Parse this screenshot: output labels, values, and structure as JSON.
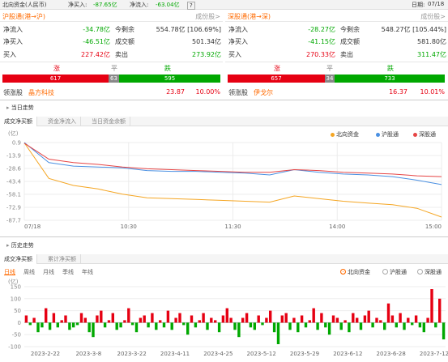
{
  "header": {
    "title": "北向资金(人民币)",
    "net_buy_label": "净买入:",
    "net_buy_value": "-87.65亿",
    "net_inflow_label": "净流入:",
    "net_inflow_value": "-63.04亿",
    "help": "?",
    "date_label": "日期:",
    "date_value": "07/18"
  },
  "sh": {
    "title": "沪股通(港→沪)",
    "link": "成份股>",
    "net_inflow_label": "净流入",
    "net_inflow_value": "-34.78亿",
    "remaining_label": "今剩余",
    "remaining_value": "554.78亿 [106.69%]",
    "net_buy_label": "净买入",
    "net_buy_value": "-46.51亿",
    "turnover_label": "成交额",
    "turnover_value": "501.34亿",
    "buy_label": "买入",
    "buy_value": "227.42亿",
    "sell_label": "卖出",
    "sell_value": "273.92亿",
    "up_label": "涨",
    "flat_label": "平",
    "down_label": "跌",
    "up_count": "617",
    "flat_count": "63",
    "down_count": "595",
    "leader_label": "领涨股",
    "leader_name": "晶方科技",
    "leader_price": "23.87",
    "leader_pct": "10.00%"
  },
  "sz": {
    "title": "深股通(港→深)",
    "link": "成份股>",
    "net_inflow_label": "净流入",
    "net_inflow_value": "-28.27亿",
    "remaining_label": "今剩余",
    "remaining_value": "548.27亿 [105.44%]",
    "net_buy_label": "净买入",
    "net_buy_value": "-41.15亿",
    "turnover_label": "成交额",
    "turnover_value": "581.80亿",
    "buy_label": "买入",
    "buy_value": "270.33亿",
    "sell_label": "卖出",
    "sell_value": "311.47亿",
    "up_label": "涨",
    "flat_label": "平",
    "down_label": "跌",
    "up_count": "657",
    "flat_count": "34",
    "down_count": "733",
    "leader_label": "领涨股",
    "leader_name": "伊戈尔",
    "leader_price": "16.37",
    "leader_pct": "10.01%"
  },
  "intraday": {
    "section_title": "当日走势",
    "tabs": [
      "成交净买额",
      "资金净流入",
      "当日资金余额"
    ],
    "unit": "(亿)",
    "legend": [
      "北向资金",
      "沪股通",
      "深股通"
    ]
  },
  "history": {
    "section_title": "历史走势",
    "tabs": [
      "成交净买额",
      "累计净买额"
    ],
    "periods": [
      "日线",
      "周线",
      "月线",
      "季线",
      "年线"
    ],
    "series_options": [
      "北向资金",
      "沪股通",
      "深股通"
    ],
    "unit": "(亿)"
  },
  "colors": {
    "north": "#f5a623",
    "sh": "#4a90e2",
    "sz": "#e64545",
    "up": "#e60012",
    "down": "#00a800",
    "accent": "#ff6a00"
  },
  "chart_data": [
    {
      "type": "line",
      "x_ticks": [
        "07/18",
        "10:30",
        "11:30",
        "14:00",
        "15:00"
      ],
      "y_ticks": [
        0.9,
        -13.9,
        -28.6,
        -43.4,
        -58.1,
        -72.9,
        -87.7
      ],
      "ylim": [
        -87.7,
        0.9
      ],
      "x": [
        "09:30",
        "09:45",
        "10:00",
        "10:15",
        "10:30",
        "10:45",
        "11:00",
        "11:15",
        "11:30",
        "13:00",
        "13:15",
        "13:30",
        "13:45",
        "14:00",
        "14:15",
        "14:30",
        "14:45",
        "15:00"
      ],
      "series": [
        {
          "name": "北向资金",
          "values": [
            0.5,
            -40,
            -48,
            -52,
            -58,
            -62,
            -63,
            -64,
            -65,
            -66,
            -67,
            -60,
            -63,
            -66,
            -68,
            -70,
            -74,
            -84
          ]
        },
        {
          "name": "沪股通",
          "values": [
            0.9,
            -22,
            -26,
            -27,
            -28,
            -31,
            -32,
            -32,
            -33,
            -34,
            -36,
            -30,
            -33,
            -35,
            -36,
            -38,
            -42,
            -47
          ]
        },
        {
          "name": "深股通",
          "values": [
            0.2,
            -18,
            -22,
            -24,
            -27,
            -29,
            -30,
            -31,
            -32,
            -33,
            -33,
            -30,
            -31,
            -33,
            -34,
            -35,
            -37,
            -38
          ]
        }
      ]
    },
    {
      "type": "bar",
      "x_ticks": [
        "2023-2-22",
        "2023-3-8",
        "2023-3-22",
        "2023-4-11",
        "2023-4-25",
        "2023-5-12",
        "2023-5-29",
        "2023-6-12",
        "2023-6-28",
        "2023-7-12"
      ],
      "y_ticks": [
        150,
        100,
        50,
        0,
        -50,
        -100
      ],
      "ylim": [
        -100,
        150
      ],
      "values": [
        30,
        -10,
        20,
        -40,
        -20,
        60,
        -30,
        40,
        -20,
        10,
        30,
        -30,
        -20,
        -10,
        40,
        20,
        -40,
        -60,
        30,
        50,
        -20,
        10,
        40,
        -30,
        -20,
        10,
        60,
        -10,
        -40,
        20,
        30,
        -20,
        40,
        -30,
        10,
        -20,
        50,
        -30,
        20,
        40,
        -10,
        -50,
        30,
        -20,
        10,
        40,
        -30,
        20,
        10,
        -40,
        30,
        60,
        20,
        -30,
        -60,
        20,
        40,
        -20,
        -30,
        30,
        -10,
        20,
        50,
        -40,
        -90,
        30,
        40,
        -30,
        20,
        -40,
        30,
        -20,
        10,
        60,
        -30,
        40,
        -20,
        -50,
        30,
        20,
        -30,
        10,
        -40,
        40,
        20,
        -30,
        30,
        50,
        -20,
        20,
        10,
        -30,
        80,
        30,
        -20,
        40,
        -30,
        20,
        -10,
        30,
        -20,
        -40,
        20,
        140,
        -20,
        100,
        -70
      ]
    }
  ]
}
